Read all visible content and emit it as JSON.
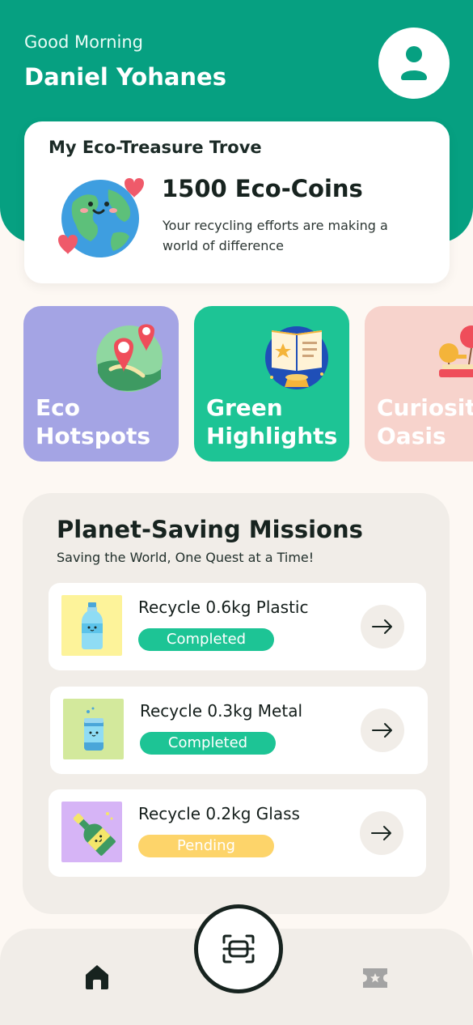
{
  "header": {
    "greeting": "Good Morning",
    "user_name": "Daniel Yohanes",
    "avatar_icon": "user-icon"
  },
  "trove": {
    "title": "My Eco-Treasure Trove",
    "coins": "1500 Eco-Coins",
    "description": "Your recycling efforts are making a world of difference"
  },
  "tiles": [
    {
      "label": "Eco\nHotspots",
      "color": "#a4a4e4",
      "icon": "map-pin-icon"
    },
    {
      "label": "Green\nHighlights",
      "color": "#1dc495",
      "icon": "book-icon"
    },
    {
      "label": "Curiosity\nOasis",
      "color": "#f7d3cc",
      "icon": "balloon-icon"
    }
  ],
  "missions": {
    "title": "Planet-Saving Missions",
    "subtitle": "Saving the World, One Quest at a Time!",
    "items": [
      {
        "name": "Recycle 0.6kg Plastic",
        "status": "Completed",
        "status_color": "#1dc495",
        "thumb_color": "#fdf39a",
        "icon": "plastic-bottle-icon"
      },
      {
        "name": "Recycle 0.3kg Metal",
        "status": "Completed",
        "status_color": "#1dc495",
        "thumb_color": "#d3e99c",
        "icon": "metal-can-icon"
      },
      {
        "name": "Recycle 0.2kg Glass",
        "status": "Pending",
        "status_color": "#fdd46a",
        "thumb_color": "#d6b4f6",
        "icon": "glass-bottle-icon"
      }
    ]
  },
  "nav": {
    "home_icon": "home-icon",
    "scan_icon": "scan-icon",
    "ticket_icon": "ticket-icon"
  },
  "colors": {
    "brand": "#06a081",
    "completed": "#1dc495",
    "pending": "#fdd46a"
  }
}
